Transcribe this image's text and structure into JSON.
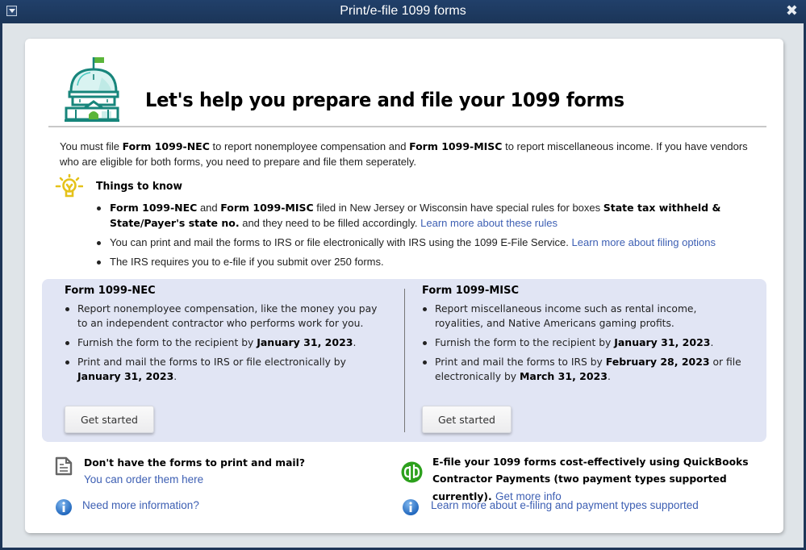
{
  "window": {
    "title": "Print/e-file 1099 forms",
    "menu_icon": "window-menu-icon",
    "close_icon": "close-icon",
    "close_glyph": "✖"
  },
  "header": {
    "icon": "capitol-building-icon",
    "title": "Let's help you prepare and file your 1099 forms"
  },
  "intro": {
    "p1": "You must file ",
    "b1": "Form 1099-NEC",
    "p2": " to report nonemployee compensation and ",
    "b2": "Form 1099-MISC",
    "p3": " to report miscellaneous income. If you have vendors who are eligible for both forms, you need to prepare and file them seperately."
  },
  "things_to_know": {
    "icon": "lightbulb-icon",
    "title": "Things to know",
    "items": [
      {
        "b1": "Form 1099-NEC",
        "t1": " and ",
        "b2": "Form 1099-MISC",
        "t2": " filed in New Jersey or Wisconsin have special rules for boxes ",
        "b3": "State tax withheld & State/Payer's state no.",
        "t3": " and they need to be filled accordingly. ",
        "link": "Learn more about these rules"
      },
      {
        "t1": "You can print and mail the forms to IRS or file electronically with IRS using the 1099 E-File Service. ",
        "link": "Learn more about filing options"
      },
      {
        "t1": "The IRS requires you to e-file if you submit over 250 forms."
      }
    ]
  },
  "forms": {
    "nec": {
      "title": "Form 1099-NEC",
      "items": [
        {
          "t1": "Report nonemployee compensation, like the money you pay to an independent contractor who performs work for you."
        },
        {
          "t1": "Furnish the form to the recipient by ",
          "b1": "January 31, 2023",
          "t2": "."
        },
        {
          "t1": "Print and mail the forms to IRS or file electronically by ",
          "b1": "January 31, 2023",
          "t2": "."
        }
      ],
      "button": "Get started"
    },
    "misc": {
      "title": "Form 1099-MISC",
      "items": [
        {
          "t1": "Report miscellaneous income such as rental income, royalities, and Native Americans gaming profits."
        },
        {
          "t1": "Furnish the form to the recipient by ",
          "b1": "January 31, 2023",
          "t2": "."
        },
        {
          "t1": "Print and mail the forms to IRS by ",
          "b1": "February 28, 2023",
          "t2": " or file electronically by ",
          "b2": "March 31, 2023",
          "t3": "."
        }
      ],
      "button": "Get started"
    }
  },
  "footer": {
    "left": {
      "icon": "document-icon",
      "question": "Don't have the forms to print and mail?",
      "order_link": "You can order them here",
      "info_icon": "info-icon",
      "info_link": "Need more information?"
    },
    "right": {
      "icon": "quickbooks-logo-icon",
      "text": "E-file your 1099 forms cost-effectively using QuickBooks Contractor Payments (two payment types supported currently).",
      "more_link": "Get more info",
      "info_icon": "info-icon",
      "info_link": "Learn more about e-filing and payment types supported"
    }
  },
  "colors": {
    "titlebar": "#1d3557",
    "link": "#3d5fb3",
    "panel": "#e1e5f4",
    "icon_teal": "#17857b",
    "icon_green": "#5bb53a",
    "bulb_yellow": "#e5c21a",
    "qb_green": "#2ca01c",
    "info_blue": "#2f78c8"
  }
}
